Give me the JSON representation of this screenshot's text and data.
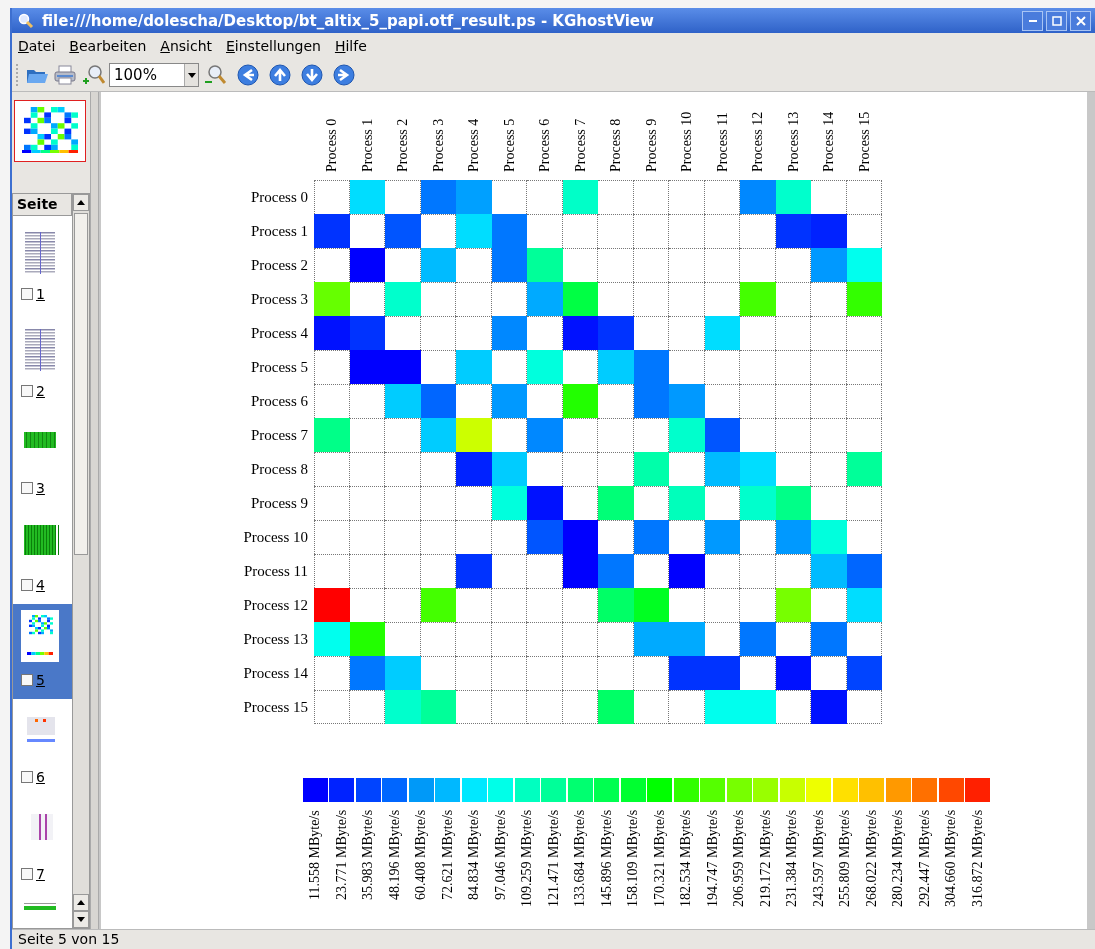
{
  "window": {
    "title": "file:///home/dolescha/Desktop/bt_altix_5_papi.otf_result.ps - KGhostView"
  },
  "menu": [
    "Datei",
    "Bearbeiten",
    "Ansicht",
    "Einstellungen",
    "Hilfe"
  ],
  "toolbar": {
    "zoom": "100%"
  },
  "sidebar": {
    "header": "Seite",
    "pages": [
      {
        "kind": "table",
        "number": "1",
        "checked": false,
        "selected": false
      },
      {
        "kind": "table",
        "number": "2",
        "checked": false,
        "selected": false
      },
      {
        "kind": "bars",
        "number": "3",
        "checked": false,
        "selected": false
      },
      {
        "kind": "dense",
        "number": "4",
        "checked": false,
        "selected": false
      },
      {
        "kind": "heatmap",
        "number": "5",
        "checked": false,
        "selected": true
      },
      {
        "kind": "grid",
        "number": "6",
        "checked": false,
        "selected": false
      },
      {
        "kind": "lines",
        "number": "7",
        "checked": false,
        "selected": false
      },
      {
        "kind": "strip"
      }
    ]
  },
  "matrix": {
    "columns": [
      "Process 0",
      "Process 1",
      "Process 2",
      "Process 3",
      "Process 4",
      "Process 5",
      "Process 6",
      "Process 7",
      "Process 8",
      "Process 9",
      "Process 10",
      "Process 11",
      "Process 12",
      "Process 13",
      "Process 14",
      "Process 15"
    ],
    "rows": [
      {
        "label": "Process 0",
        "cells": [
          null,
          {
            "color": "#00ddff"
          },
          null,
          {
            "color": "#0077ff"
          },
          {
            "color": "#00a0ff"
          },
          null,
          null,
          {
            "color": "#00ffc8"
          },
          null,
          null,
          null,
          null,
          {
            "color": "#0088ff"
          },
          {
            "color": "#00ffcc"
          },
          null,
          null
        ]
      },
      {
        "label": "Process 1",
        "cells": [
          {
            "color": "#0033ff"
          },
          null,
          {
            "color": "#0055ff"
          },
          null,
          {
            "color": "#00ddff"
          },
          {
            "color": "#0077ff"
          },
          null,
          null,
          null,
          null,
          null,
          null,
          null,
          {
            "color": "#0033ff"
          },
          {
            "color": "#0022ff"
          },
          null
        ]
      },
      {
        "label": "Process 2",
        "cells": [
          null,
          {
            "color": "#0000ff"
          },
          null,
          {
            "color": "#00bbff"
          },
          null,
          {
            "color": "#0077ff"
          },
          {
            "color": "#00ff99"
          },
          null,
          null,
          null,
          null,
          null,
          null,
          null,
          {
            "color": "#0099ff"
          },
          {
            "color": "#00ffee"
          }
        ]
      },
      {
        "label": "Process 3",
        "cells": [
          {
            "color": "#66ff00"
          },
          null,
          {
            "color": "#00ffcc"
          },
          null,
          null,
          null,
          {
            "color": "#00aaff"
          },
          {
            "color": "#00ff44"
          },
          null,
          null,
          null,
          null,
          {
            "color": "#44ff00"
          },
          null,
          null,
          {
            "color": "#33ff00"
          }
        ]
      },
      {
        "label": "Process 4",
        "cells": [
          {
            "color": "#0011ff"
          },
          {
            "color": "#0033ff"
          },
          null,
          null,
          null,
          {
            "color": "#0088ff"
          },
          null,
          {
            "color": "#0011ff"
          },
          {
            "color": "#0033ff"
          },
          null,
          null,
          {
            "color": "#00ddff"
          },
          null,
          null,
          null,
          null
        ]
      },
      {
        "label": "Process 5",
        "cells": [
          null,
          {
            "color": "#0000ff"
          },
          {
            "color": "#0000ff"
          },
          null,
          {
            "color": "#00ccff"
          },
          null,
          {
            "color": "#00ffdd"
          },
          null,
          {
            "color": "#00ccff"
          },
          {
            "color": "#0077ff"
          },
          null,
          null,
          null,
          null,
          null,
          null
        ]
      },
      {
        "label": "Process 6",
        "cells": [
          null,
          null,
          {
            "color": "#00ccff"
          },
          {
            "color": "#0066ff"
          },
          null,
          {
            "color": "#0099ff"
          },
          null,
          {
            "color": "#22ff00"
          },
          null,
          {
            "color": "#0077ff"
          },
          {
            "color": "#0099ff"
          },
          null,
          null,
          null,
          null,
          null
        ]
      },
      {
        "label": "Process 7",
        "cells": [
          {
            "color": "#00ff88"
          },
          null,
          null,
          {
            "color": "#00ccff"
          },
          {
            "color": "#ccff00"
          },
          null,
          {
            "color": "#0088ff"
          },
          null,
          null,
          null,
          {
            "color": "#00ffcc"
          },
          {
            "color": "#0055ff"
          },
          null,
          null,
          null,
          null
        ]
      },
      {
        "label": "Process 8",
        "cells": [
          null,
          null,
          null,
          null,
          {
            "color": "#0022ff"
          },
          {
            "color": "#00ccff"
          },
          null,
          null,
          null,
          {
            "color": "#00ffaa"
          },
          null,
          {
            "color": "#00bbff"
          },
          {
            "color": "#00ddff"
          },
          null,
          null,
          {
            "color": "#00ff99"
          }
        ]
      },
      {
        "label": "Process 9",
        "cells": [
          null,
          null,
          null,
          null,
          null,
          {
            "color": "#00ffdd"
          },
          {
            "color": "#0011ff"
          },
          null,
          {
            "color": "#00ff77"
          },
          null,
          {
            "color": "#00ffbb"
          },
          null,
          {
            "color": "#00ffcc"
          },
          {
            "color": "#00ff88"
          },
          null,
          null
        ]
      },
      {
        "label": "Process 10",
        "cells": [
          null,
          null,
          null,
          null,
          null,
          null,
          {
            "color": "#0055ff"
          },
          {
            "color": "#0000ff"
          },
          null,
          {
            "color": "#0077ff"
          },
          null,
          {
            "color": "#0099ff"
          },
          null,
          {
            "color": "#0099ff"
          },
          {
            "color": "#00ffdd"
          },
          null
        ]
      },
      {
        "label": "Process 11",
        "cells": [
          null,
          null,
          null,
          null,
          {
            "color": "#0033ff"
          },
          null,
          null,
          {
            "color": "#0000ff"
          },
          {
            "color": "#0077ff"
          },
          null,
          {
            "color": "#0000ff"
          },
          null,
          null,
          null,
          {
            "color": "#00bbff"
          },
          {
            "color": "#0066ff"
          }
        ]
      },
      {
        "label": "Process 12",
        "cells": [
          {
            "color": "#ff0000"
          },
          null,
          null,
          {
            "color": "#44ff00"
          },
          null,
          null,
          null,
          null,
          {
            "color": "#00ff66"
          },
          {
            "color": "#00ff22"
          },
          null,
          null,
          null,
          {
            "color": "#77ff00"
          },
          null,
          {
            "color": "#00ddff"
          }
        ]
      },
      {
        "label": "Process 13",
        "cells": [
          {
            "color": "#00ffee"
          },
          {
            "color": "#22ff00"
          },
          null,
          null,
          null,
          null,
          null,
          null,
          null,
          {
            "color": "#00aaff"
          },
          {
            "color": "#00aaff"
          },
          null,
          {
            "color": "#0077ff"
          },
          null,
          {
            "color": "#0077ff"
          },
          null
        ]
      },
      {
        "label": "Process 14",
        "cells": [
          null,
          {
            "color": "#0077ff"
          },
          {
            "color": "#00ccff"
          },
          null,
          null,
          null,
          null,
          null,
          null,
          null,
          {
            "color": "#0033ff"
          },
          {
            "color": "#0033ff"
          },
          null,
          {
            "color": "#0011ff"
          },
          null,
          {
            "color": "#0044ff"
          }
        ]
      },
      {
        "label": "Process 15",
        "cells": [
          null,
          null,
          {
            "color": "#00ffcc"
          },
          {
            "color": "#00ff99"
          },
          null,
          null,
          null,
          null,
          {
            "color": "#00ff66"
          },
          null,
          null,
          {
            "color": "#00ffee"
          },
          {
            "color": "#00ffee"
          },
          null,
          {
            "color": "#0011ff"
          },
          null
        ]
      }
    ]
  },
  "legend": [
    {
      "color": "#0000ff",
      "label": "11.558 MByte/s"
    },
    {
      "color": "#0022ff",
      "label": "23.771 MByte/s"
    },
    {
      "color": "#0044ff",
      "label": "35.983 MByte/s"
    },
    {
      "color": "#0066ff",
      "label": "48.196 MByte/s"
    },
    {
      "color": "#0099f8",
      "label": "60.408 MByte/s"
    },
    {
      "color": "#00b8ff",
      "label": "72.621 MByte/s"
    },
    {
      "color": "#00e8ff",
      "label": "84.834 MByte/s"
    },
    {
      "color": "#00ffe8",
      "label": "97.046 MByte/s"
    },
    {
      "color": "#00ffc0",
      "label": "109.259 MByte/s"
    },
    {
      "color": "#00ff99",
      "label": "121.471 MByte/s"
    },
    {
      "color": "#00ff70",
      "label": "133.684 MByte/s"
    },
    {
      "color": "#00ff50",
      "label": "145.896 MByte/s"
    },
    {
      "color": "#00ff30",
      "label": "158.109 MByte/s"
    },
    {
      "color": "#00ff00",
      "label": "170.321 MByte/s"
    },
    {
      "color": "#30ff00",
      "label": "182.534 MByte/s"
    },
    {
      "color": "#55ff00",
      "label": "194.747 MByte/s"
    },
    {
      "color": "#77ff00",
      "label": "206.959 MByte/s"
    },
    {
      "color": "#99ff00",
      "label": "219.172 MByte/s"
    },
    {
      "color": "#c8ff00",
      "label": "231.384 MByte/s"
    },
    {
      "color": "#eeff00",
      "label": "243.597 MByte/s"
    },
    {
      "color": "#ffe000",
      "label": "255.809 MByte/s"
    },
    {
      "color": "#ffc000",
      "label": "268.022 MByte/s"
    },
    {
      "color": "#ff9900",
      "label": "280.234 MByte/s"
    },
    {
      "color": "#ff7000",
      "label": "292.447 MByte/s"
    },
    {
      "color": "#ff4800",
      "label": "304.660 MByte/s"
    },
    {
      "color": "#ff2000",
      "label": "316.872 MByte/s"
    }
  ],
  "status_bar": "Seite 5 von 15"
}
